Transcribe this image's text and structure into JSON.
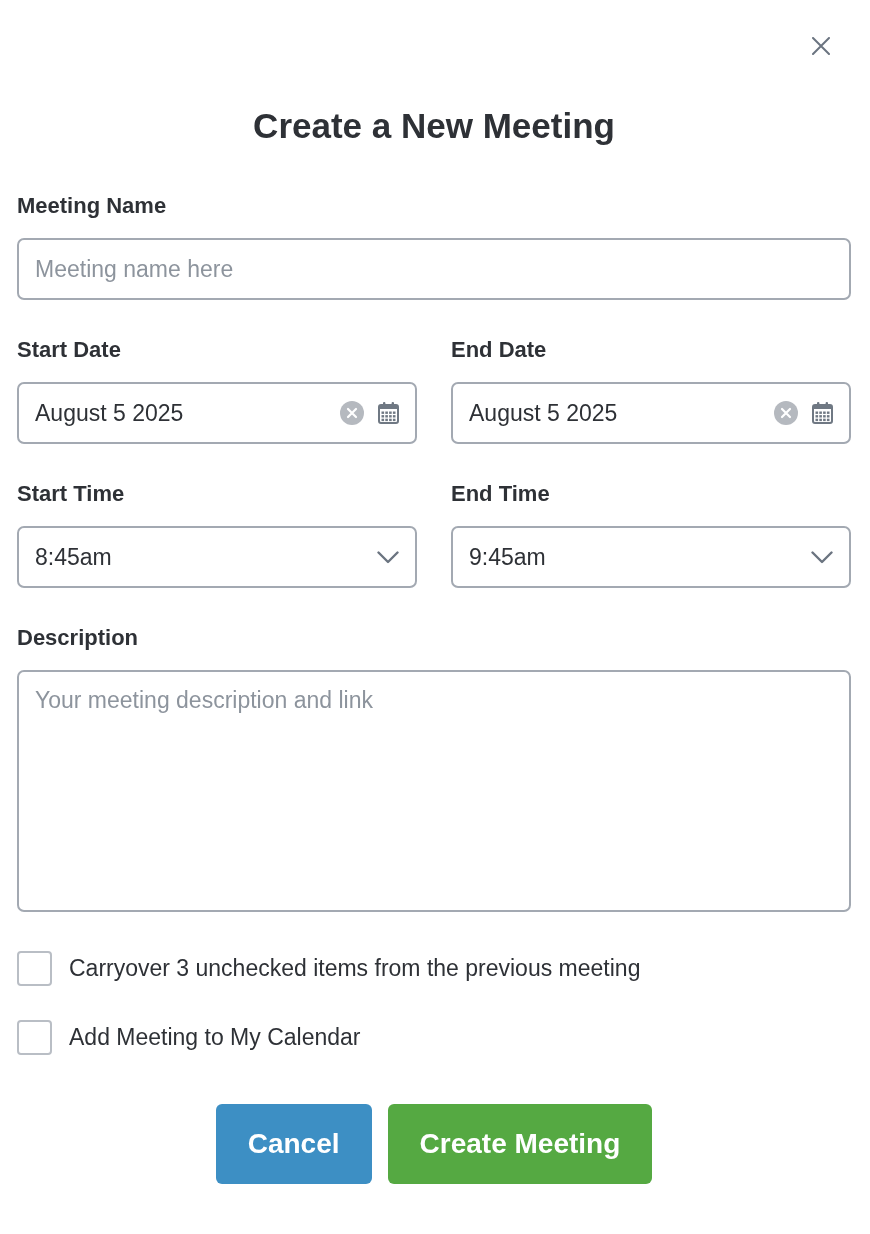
{
  "title": "Create a New Meeting",
  "rows": [
    {
      "fields": [
        {
          "kind": "text",
          "label": "Meeting Name",
          "placeholder": "Meeting name here"
        }
      ]
    },
    {
      "fields": [
        {
          "kind": "date",
          "label": "Start Date",
          "value": "August 5 2025"
        },
        {
          "kind": "date",
          "label": "End Date",
          "value": "August 5 2025"
        }
      ]
    },
    {
      "fields": [
        {
          "kind": "select",
          "label": "Start Time",
          "value": "8:45am"
        },
        {
          "kind": "select",
          "label": "End Time",
          "value": "9:45am"
        }
      ]
    },
    {
      "fields": [
        {
          "kind": "textarea",
          "label": "Description",
          "placeholder": "Your meeting description and link"
        }
      ]
    }
  ],
  "checkboxes": [
    {
      "label": "Carryover 3 unchecked items from the previous meeting",
      "checked": false
    },
    {
      "label": "Add Meeting to My Calendar",
      "checked": false
    }
  ],
  "buttons": [
    {
      "label": "Cancel",
      "kind": "secondary"
    },
    {
      "label": "Create Meeting",
      "kind": "primary"
    }
  ]
}
